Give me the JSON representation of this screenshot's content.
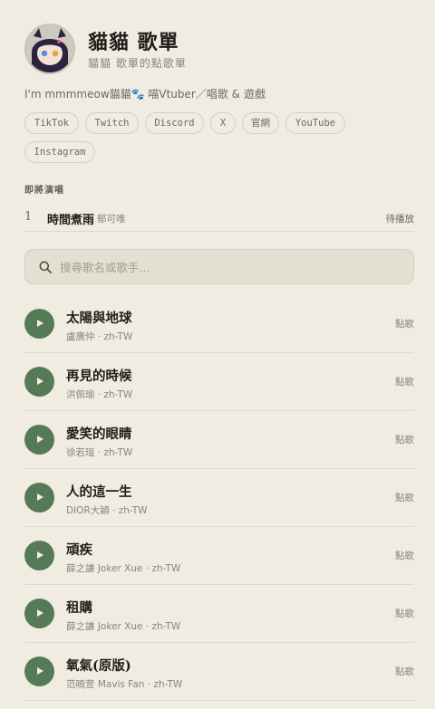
{
  "header": {
    "title": "貓貓 歌單",
    "subtitle": "貓貓 歌單的點歌單"
  },
  "bio": "I'm mmmmeow貓貓🐾 喵Vtuber／唱歌 & 遊戲",
  "links": [
    "TikTok",
    "Twitch",
    "Discord",
    "X",
    "官網",
    "YouTube",
    "Instagram"
  ],
  "up_next": {
    "title": "即將演唱",
    "items": [
      {
        "number": "1",
        "song": "時間煮雨",
        "artist": "郁可唯",
        "status": "待播放"
      }
    ]
  },
  "search": {
    "placeholder": "搜尋歌名或歌手..."
  },
  "songs": [
    {
      "title": "太陽與地球",
      "artist": "盧廣仲",
      "lang": "zh-TW",
      "action": "點歌"
    },
    {
      "title": "再見的時候",
      "artist": "洪佩瑜",
      "lang": "zh-TW",
      "action": "點歌"
    },
    {
      "title": "愛笑的眼睛",
      "artist": "徐若瑄",
      "lang": "zh-TW",
      "action": "點歌"
    },
    {
      "title": "人的這一生",
      "artist": "DIOR大穎",
      "lang": "zh-TW",
      "action": "點歌"
    },
    {
      "title": "頑疾",
      "artist": "薛之謙 Joker Xue",
      "lang": "zh-TW",
      "action": "點歌"
    },
    {
      "title": "租購",
      "artist": "薛之謙 Joker Xue",
      "lang": "zh-TW",
      "action": "點歌"
    },
    {
      "title": "氧氣(原版)",
      "artist": "范曉萱 Mavis Fan",
      "lang": "zh-TW",
      "action": "點歌"
    }
  ],
  "meta_separator": " · ",
  "colors": {
    "background": "#f1ece1",
    "accent": "#557a57",
    "chip_border": "#d4cfc3",
    "search_bg": "#e4dfd3"
  },
  "icons": {
    "search": "search-icon",
    "play": "play-icon"
  }
}
